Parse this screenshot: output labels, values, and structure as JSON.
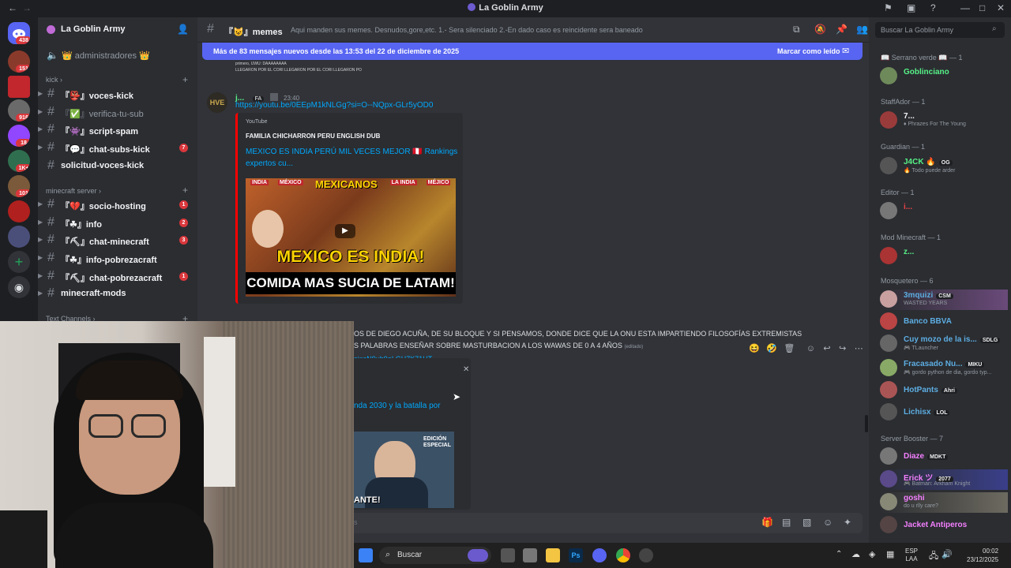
{
  "window": {
    "title": "La Goblin Army"
  },
  "rail": {
    "badges": [
      "438",
      "151",
      "916",
      "18",
      "1K+",
      "101"
    ]
  },
  "guild": {
    "name": "La Goblin Army"
  },
  "sidebar": {
    "top_channel": "👑 administradores 👑",
    "categories": [
      {
        "name": "kick",
        "channels": [
          {
            "name": "『👺』voces-kick",
            "count": ""
          },
          {
            "name": "『✅』verifica-tu-sub",
            "count": "",
            "dim": true
          },
          {
            "name": "『👾』script-spam",
            "count": ""
          },
          {
            "name": "『💬』chat-subs-kick",
            "count": "7"
          },
          {
            "name": "solicitud-voces-kick",
            "count": ""
          }
        ]
      },
      {
        "name": "minecraft server",
        "channels": [
          {
            "name": "『💔』socio-hosting",
            "count": "1"
          },
          {
            "name": "『☘』info",
            "count": "2"
          },
          {
            "name": "『⛏』chat-minecraft",
            "count": "3"
          },
          {
            "name": "『☘』info-pobrezacraft",
            "count": ""
          },
          {
            "name": "『⛏』chat-pobrezacraft",
            "count": "1"
          },
          {
            "name": "minecraft-mods",
            "count": ""
          }
        ]
      },
      {
        "name": "Text Channels",
        "channels": []
      }
    ]
  },
  "channel": {
    "name": "『😺』memes",
    "topic": "Aqui manden sus memes. Desnudos,gore,etc. 1.- Sera silenciado 2.-En dado caso es reincidente sera baneado",
    "new_messages_text": "Más de 83 mensajes nuevos desde las 13:53 del 22 de diciembre de 2025",
    "mark_read": "Marcar como leído"
  },
  "messages": {
    "quoted_1": "primero, UWU: DAAAAAAAA",
    "quoted_2": "LLEGARON POR EL CORI LLEGARON POR EL CORI LLEGARON PO",
    "author": "j...",
    "author_tag": "FA",
    "time": "23:40",
    "link": "https://youtu.be/0EEpM1kNLGg?si=O--NQpx-GLr5yOD0",
    "embed": {
      "provider": "YouTube",
      "channel": "FAMILIA CHICHARRON PERU ENGLISH DUB",
      "title": "MEXICO ES INDIA PERÚ MIL VECES MEJOR 🇵🇪 Rankings expertos cu...",
      "thumb_line1": "MEXICO ES INDIA!",
      "thumb_line2": "COMIDA MAS SUCIA DE LATAM!",
      "thumb_top": "MEXICANOS",
      "thumb_tags": [
        "INDIA",
        "MÉXICO",
        "LA INDIA",
        "MÉJICO"
      ]
    },
    "msg2_line1": "OS DE DIEGO ACUÑA, DE SU BLOQUE Y SI PENSAMOS, DONDE DICE QUE LA ONU ESTA IMPARTIENDO FILOSOFÍAS EXTREMISTAS",
    "msg2_line2": "S PALABRAS ENSEÑAR SOBRE MASTURBACION A LOS WAWAS DE 0 A 4 AÑOS",
    "edited": "(editado)",
    "link2": "si=sN9uh9aLGH7K71HT",
    "embed2_title": "nda 2030 y la batalla por",
    "embed2_badge": "EDICIÓN ESPECIAL",
    "embed2_bottom": "ANTE!",
    "input_fragment": "s"
  },
  "members": {
    "search_placeholder": "Buscar La Goblin Army",
    "groups": [
      {
        "role": "📖 Serrano verde 📖 — 1",
        "members": [
          {
            "name": "Goblinciano",
            "status": "",
            "color": "#57f287",
            "tag": ""
          }
        ]
      },
      {
        "role": "StaffAdor — 1",
        "members": [
          {
            "name": "7...",
            "status": "♦ Phrazes For The Young",
            "color": "#f2f3f5",
            "tag": ""
          }
        ]
      },
      {
        "role": "Guardian — 1",
        "members": [
          {
            "name": "J4CK 🔥",
            "status": "🔥 Todo puede arder",
            "color": "#57f287",
            "tag": "OG"
          }
        ]
      },
      {
        "role": "Editor — 1",
        "members": [
          {
            "name": "i...",
            "status": "",
            "color": "#ed4245",
            "tag": ""
          }
        ]
      },
      {
        "role": "Mod Minecraft — 1",
        "members": [
          {
            "name": "z...",
            "status": "",
            "color": "#57f287",
            "tag": ""
          }
        ]
      },
      {
        "role": "Mosquetero — 6",
        "members": [
          {
            "name": "3mquizi",
            "status": "WASTED YEARS",
            "color": "#5dade2",
            "tag": "CSM"
          },
          {
            "name": "Banco BBVA",
            "status": "",
            "color": "#5dade2",
            "tag": ""
          },
          {
            "name": "Cuy mozo de la is...",
            "status": "🎮 TLauncher",
            "color": "#5dade2",
            "tag": "SDLG"
          },
          {
            "name": "Fracasado Nu...",
            "status": "🎮 gordo python de dia, gordo typ...",
            "color": "#5dade2",
            "tag": "MIKU"
          },
          {
            "name": "HotPants",
            "status": "",
            "color": "#5dade2",
            "tag": "Ahri"
          },
          {
            "name": "Lichisx",
            "status": "",
            "color": "#5dade2",
            "tag": "LOL"
          }
        ]
      },
      {
        "role": "Server Booster — 7",
        "members": [
          {
            "name": "Diaze",
            "status": "",
            "color": "#f47fff",
            "tag": "MDKT"
          },
          {
            "name": "Erick ツ",
            "status": "🎮 Batman: Arkham Knight",
            "color": "#f47fff",
            "tag": "2077"
          },
          {
            "name": "goshi",
            "status": "do u rlly care?",
            "color": "#f47fff",
            "tag": ""
          },
          {
            "name": "Jacket Antiperos",
            "status": "",
            "color": "#f47fff",
            "tag": ""
          }
        ]
      }
    ]
  },
  "taskbar": {
    "search": "Buscar",
    "lang": "ESP",
    "lang2": "LAA",
    "time": "00:02",
    "date": "23/12/2025"
  }
}
